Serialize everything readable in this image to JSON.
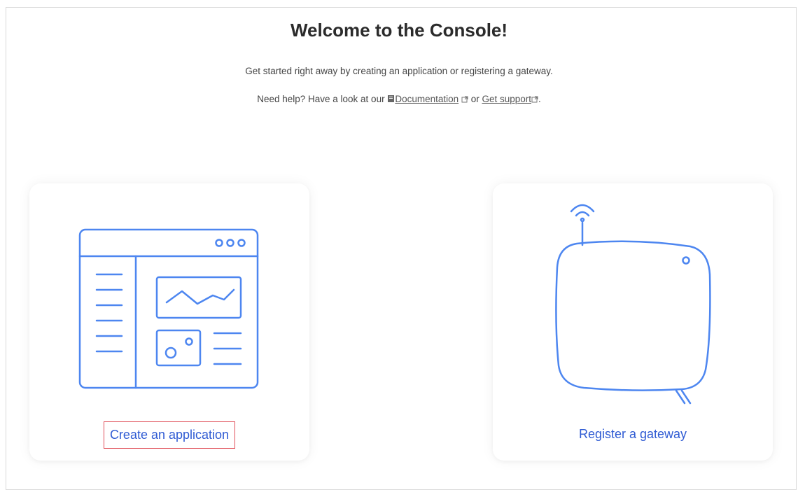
{
  "header": {
    "title": "Welcome to the Console!",
    "subtitle": "Get started right away by creating an application or registering a gateway.",
    "help_prefix": "Need help? Have a look at our",
    "documentation_label": "Documentation",
    "or_text": "or",
    "support_label": "Get support",
    "period": "."
  },
  "cards": {
    "application": {
      "label": "Create an application",
      "icon": "application-window-icon"
    },
    "gateway": {
      "label": "Register a gateway",
      "icon": "gateway-device-icon"
    }
  },
  "colors": {
    "accent": "#2f5bd3",
    "illustration": "#4d86f0",
    "highlight": "#e0505a"
  }
}
